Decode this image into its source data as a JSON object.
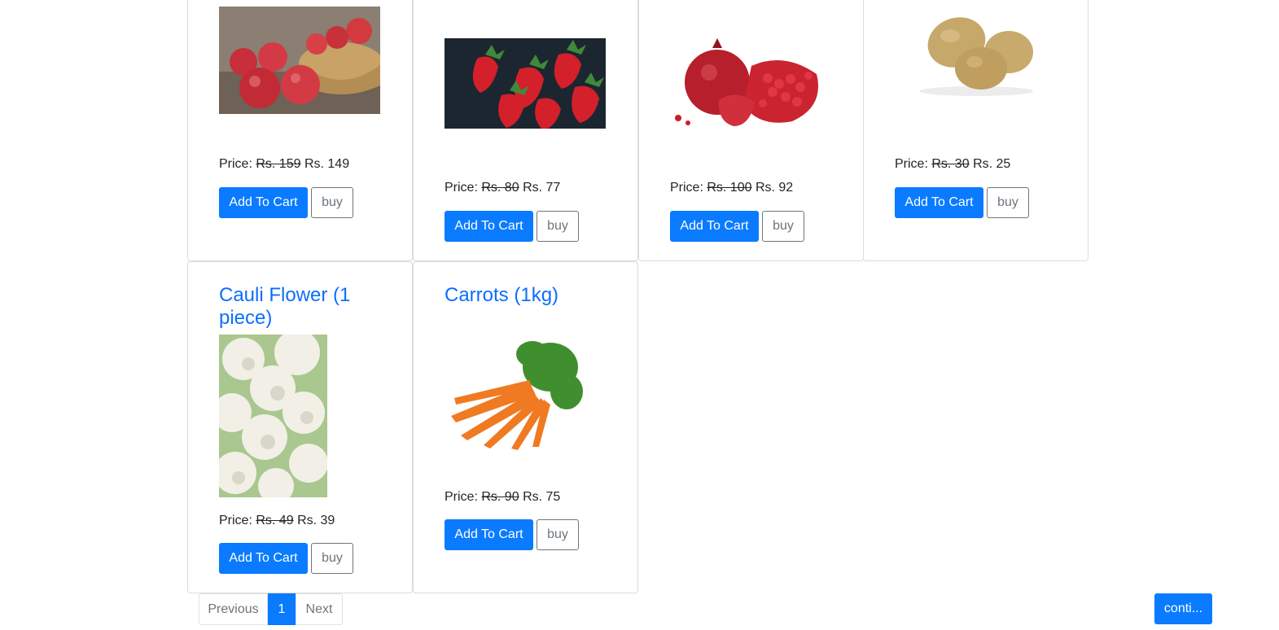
{
  "labels": {
    "price_prefix": "Price:",
    "add_to_cart": "Add To Cart",
    "buy": "buy"
  },
  "products": [
    {
      "image": "apples-image",
      "old_price": "Rs. 159",
      "new_price": "Rs. 149"
    },
    {
      "image": "strawberries-image",
      "old_price": "Rs. 80",
      "new_price": "Rs. 77"
    },
    {
      "image": "pomegranate-image",
      "old_price": "Rs. 100",
      "new_price": "Rs. 92"
    },
    {
      "image": "potatoes-image",
      "old_price": "Rs. 30",
      "new_price": "Rs. 25"
    },
    {
      "title": "Cauli Flower (1 piece)",
      "image": "cauliflower-image",
      "old_price": "Rs. 49",
      "new_price": "Rs. 39"
    },
    {
      "title": "Carrots (1kg)",
      "image": "carrots-image",
      "old_price": "Rs. 90",
      "new_price": "Rs. 75"
    }
  ],
  "pagination": {
    "previous": "Previous",
    "current": "1",
    "next": "Next"
  },
  "continue_label": "conti...",
  "colors": {
    "primary": "#0a7bff",
    "title": "#0d6efd",
    "border": "#dcdcdc",
    "secondary": "#6c757d"
  }
}
